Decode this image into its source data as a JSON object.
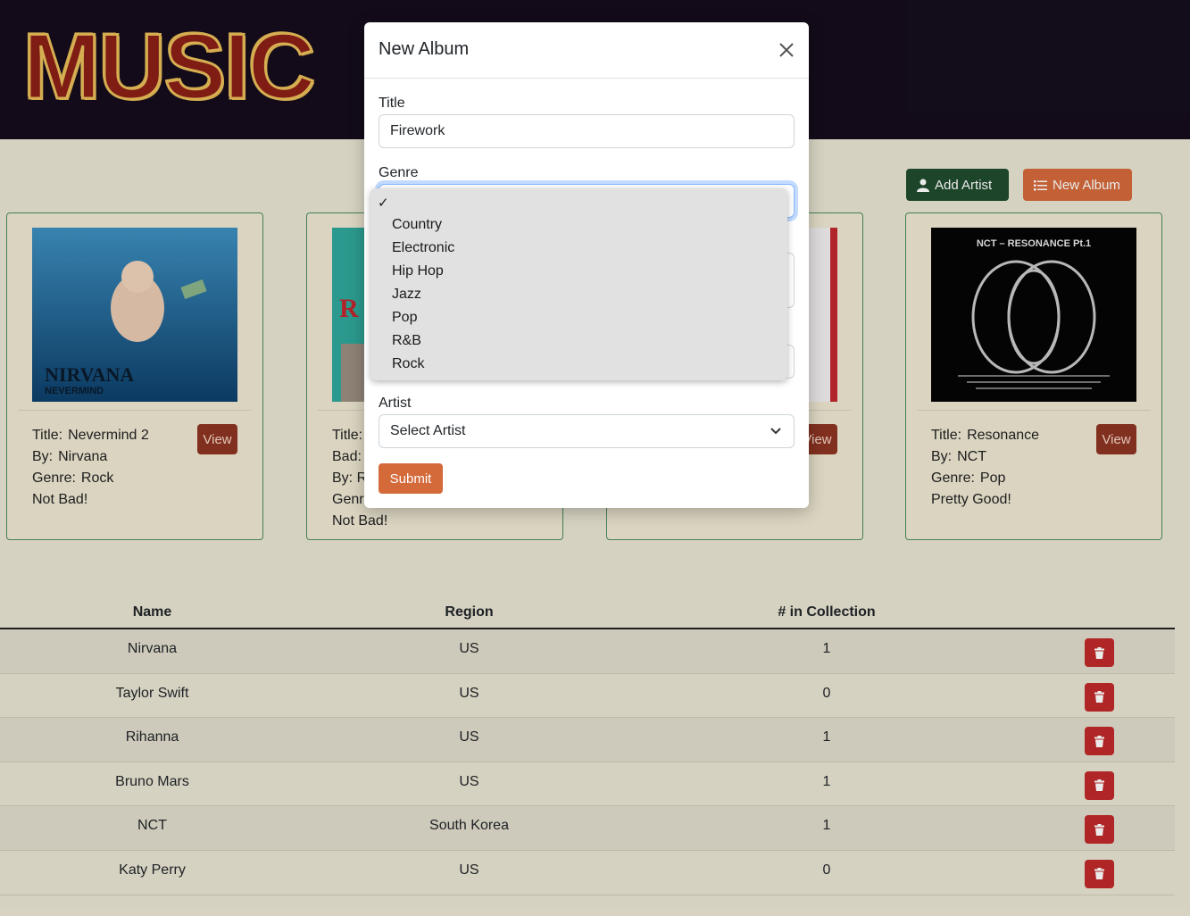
{
  "header": {
    "logo_letters": [
      "M",
      "U",
      "S",
      "I",
      "C"
    ]
  },
  "toolbar": {
    "add_artist_label": "Add Artist",
    "new_album_label": "New Album"
  },
  "cards": [
    {
      "title_key": "Title:",
      "title": "Nevermind 2",
      "by_key": "By:",
      "by": "Nirvana",
      "genre_key": "Genre:",
      "genre": "Rock",
      "review": "Not Bad!",
      "view": "View"
    },
    {
      "line1": "Title:",
      "line2": "Bad:",
      "line3": "By:  R",
      "line4": "Genre",
      "review": "Not Bad!"
    },
    {
      "view": "View"
    },
    {
      "title_key": "Title:",
      "title": "Resonance",
      "by_key": "By:",
      "by": "NCT",
      "genre_key": "Genre:",
      "genre": "Pop",
      "review": "Pretty Good!",
      "view": "View"
    }
  ],
  "table": {
    "headers": [
      "Name",
      "Region",
      "# in Collection"
    ],
    "rows": [
      {
        "name": "Nirvana",
        "region": "US",
        "count": "1"
      },
      {
        "name": "Taylor Swift",
        "region": "US",
        "count": "0"
      },
      {
        "name": "Rihanna",
        "region": "US",
        "count": "1"
      },
      {
        "name": "Bruno Mars",
        "region": "US",
        "count": "1"
      },
      {
        "name": "NCT",
        "region": "South Korea",
        "count": "1"
      },
      {
        "name": "Katy Perry",
        "region": "US",
        "count": "0"
      }
    ]
  },
  "modal": {
    "title": "New Album",
    "title_label": "Title",
    "title_value": "Firework",
    "genre_label": "Genre",
    "artist_label": "Artist",
    "artist_value": "Select Artist",
    "submit_label": "Submit"
  },
  "genre_dropdown": {
    "selected_mark": "✓",
    "options": [
      "Country",
      "Electronic",
      "Hip Hop",
      "Jazz",
      "Pop",
      "R&B",
      "Rock"
    ]
  },
  "colors": {
    "header_bg": "#150d1c",
    "add_artist": "#1f4b2e",
    "new_album": "#d4693a",
    "delete": "#bf2a2a",
    "view": "#8c3522"
  },
  "cover_art": {
    "nirvana_text": [
      "NIRVANA",
      "NEVERMIND"
    ],
    "card2_text": "R",
    "nct_text": "NCT – RESONANCE Pt.1"
  }
}
